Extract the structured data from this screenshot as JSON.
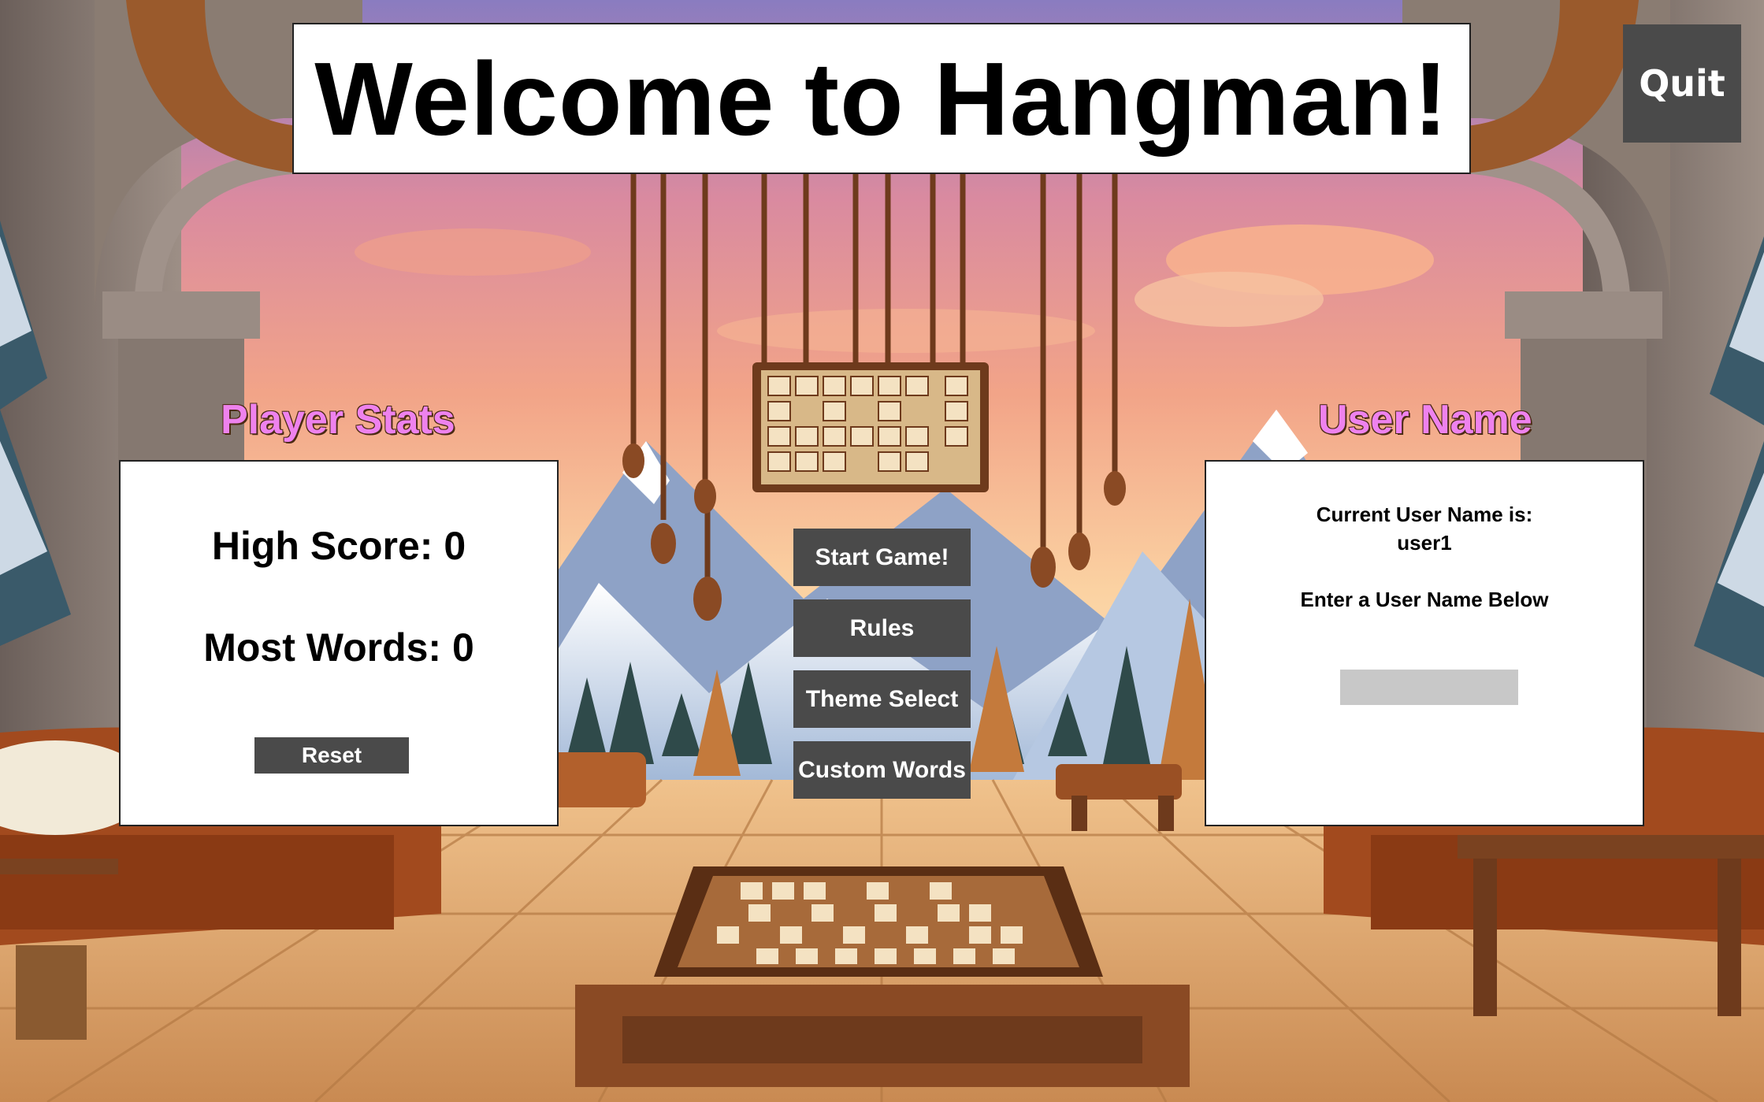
{
  "window": {
    "title": "Welcome to Hangman!"
  },
  "header": {
    "quit_label": "Quit"
  },
  "player_stats": {
    "heading": "Player Stats",
    "high_score": "High Score: 0",
    "most_words": "Most Words: 0",
    "reset_label": "Reset"
  },
  "user_name": {
    "heading": "User Name",
    "current_label": "Current User Name is:",
    "current_value": "user1",
    "enter_label": "Enter a User Name Below",
    "input_value": ""
  },
  "menu": {
    "start_label": "Start Game!",
    "rules_label": "Rules",
    "theme_label": "Theme Select",
    "custom_label": "Custom Words"
  },
  "colors": {
    "heading_accent": "#ee82ee",
    "button_bg": "#4a4a4a",
    "panel_bg": "#ffffff",
    "input_bg": "#c8c8c8"
  },
  "icons": {
    "background": "cabin-mountain-sunset-scene",
    "hanging_board": "hanging-letter-board",
    "table_board": "letter-board-table"
  }
}
